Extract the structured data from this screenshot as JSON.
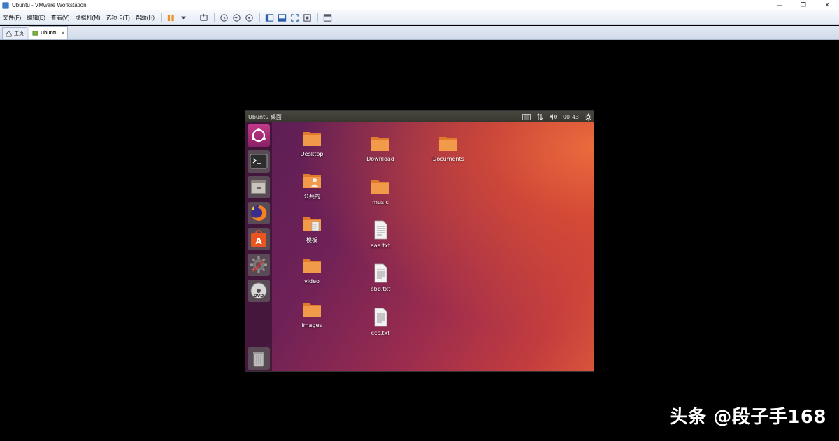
{
  "window": {
    "title": "Ubuntu - VMware Workstation",
    "minimize": "—",
    "restore": "❐",
    "close": "✕"
  },
  "menu": [
    "文件(F)",
    "编辑(E)",
    "查看(V)",
    "虚拟机(M)",
    "选项卡(T)",
    "帮助(H)"
  ],
  "tabs": [
    {
      "label": "主页",
      "icon": "home-icon"
    },
    {
      "label": "Ubuntu",
      "icon": "vm-icon",
      "active": true,
      "close": "×"
    }
  ],
  "guest": {
    "topbar_title": "Ubuntu 桌面",
    "clock": "00:43",
    "launcher": [
      "ubuntu-dash",
      "terminal",
      "file-manager",
      "firefox",
      "software-center",
      "system-settings",
      "dvd",
      "trash"
    ],
    "desktop_icons": [
      {
        "label": "Desktop",
        "type": "folder"
      },
      {
        "label": "公共的",
        "type": "folder-public"
      },
      {
        "label": "模板",
        "type": "folder-templates"
      },
      {
        "label": "video",
        "type": "folder"
      },
      {
        "label": "images",
        "type": "folder"
      },
      {
        "label": "Download",
        "type": "folder"
      },
      {
        "label": "music",
        "type": "folder"
      },
      {
        "label": "aaa.txt",
        "type": "text-file"
      },
      {
        "label": "bbb.txt",
        "type": "text-file"
      },
      {
        "label": "ccc.txt",
        "type": "text-file"
      },
      {
        "label": "Documents",
        "type": "folder"
      }
    ]
  },
  "watermark": "头条 @段子手168",
  "colors": {
    "titlebar_bg": "#ffffff",
    "menubar_bg": "#e4ebf5",
    "ubuntu_orange": "#e95420",
    "launcher_bg": "#37142f",
    "folder_orange": "#f19a4a"
  }
}
